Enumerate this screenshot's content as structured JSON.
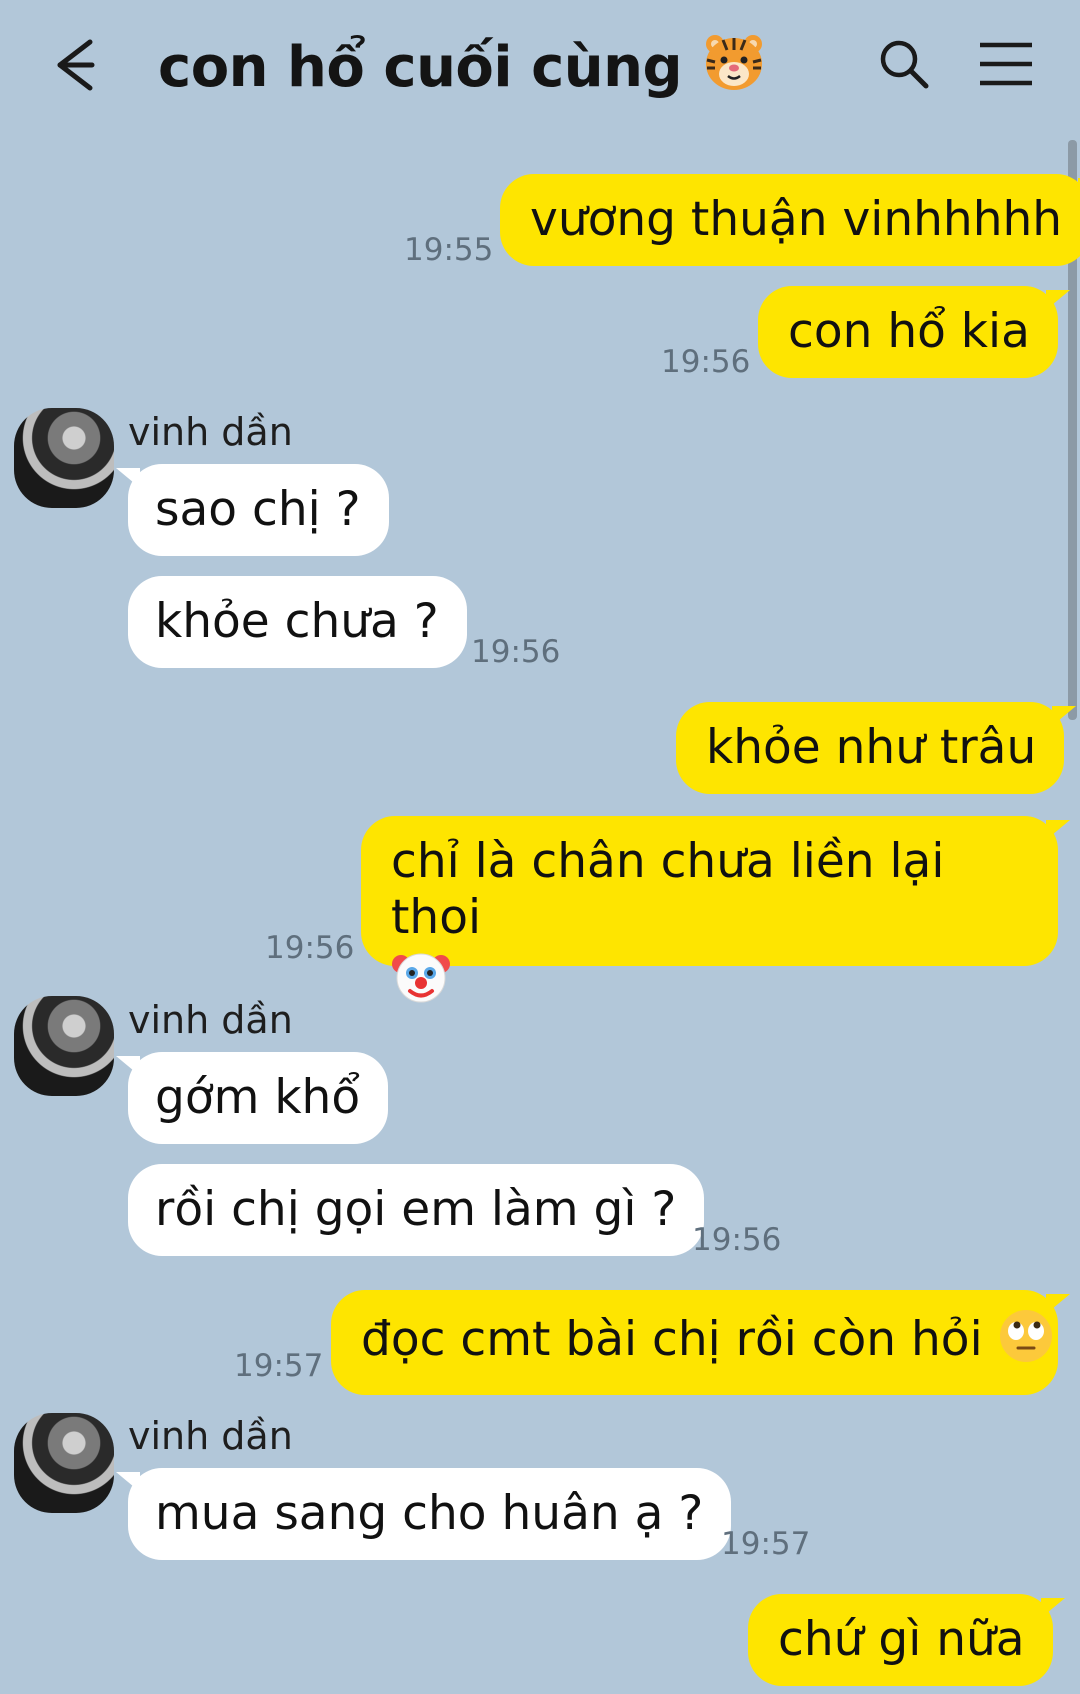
{
  "header": {
    "title": "con hổ cuối cùng",
    "title_emoji": "tiger-face-icon",
    "back_icon": "back-arrow-icon",
    "search_icon": "search-icon",
    "menu_icon": "menu-icon"
  },
  "colors": {
    "background": "#b2c7d9",
    "my_bubble": "#fee500",
    "their_bubble": "#ffffff",
    "time_text": "#5f6f7d"
  },
  "messages": [
    {
      "from": "me",
      "text": "vương thuận vinhhhhh",
      "time": "19:55"
    },
    {
      "from": "me",
      "text": "con hổ kia",
      "time": "19:56"
    },
    {
      "from": "them",
      "sender": "vinh dần",
      "text": "sao chị ?"
    },
    {
      "from": "them",
      "text": "khỏe chưa ?",
      "time": "19:56"
    },
    {
      "from": "me",
      "text": "khỏe như trâu"
    },
    {
      "from": "me",
      "text": "chỉ là chân chưa liền lại thoi",
      "emoji": "clown-face-icon",
      "time": "19:56"
    },
    {
      "from": "them",
      "sender": "vinh dần",
      "text": "gớm khổ"
    },
    {
      "from": "them",
      "text": "rồi chị gọi em làm gì ?",
      "time": "19:56"
    },
    {
      "from": "me",
      "text": "đọc cmt bài chị rồi còn hỏi",
      "emoji": "eye-roll-face-icon",
      "time": "19:57"
    },
    {
      "from": "them",
      "sender": "vinh dần",
      "text": "mua sang cho huân ạ ?",
      "time": "19:57"
    },
    {
      "from": "me",
      "text": "chứ gì nữa"
    }
  ]
}
